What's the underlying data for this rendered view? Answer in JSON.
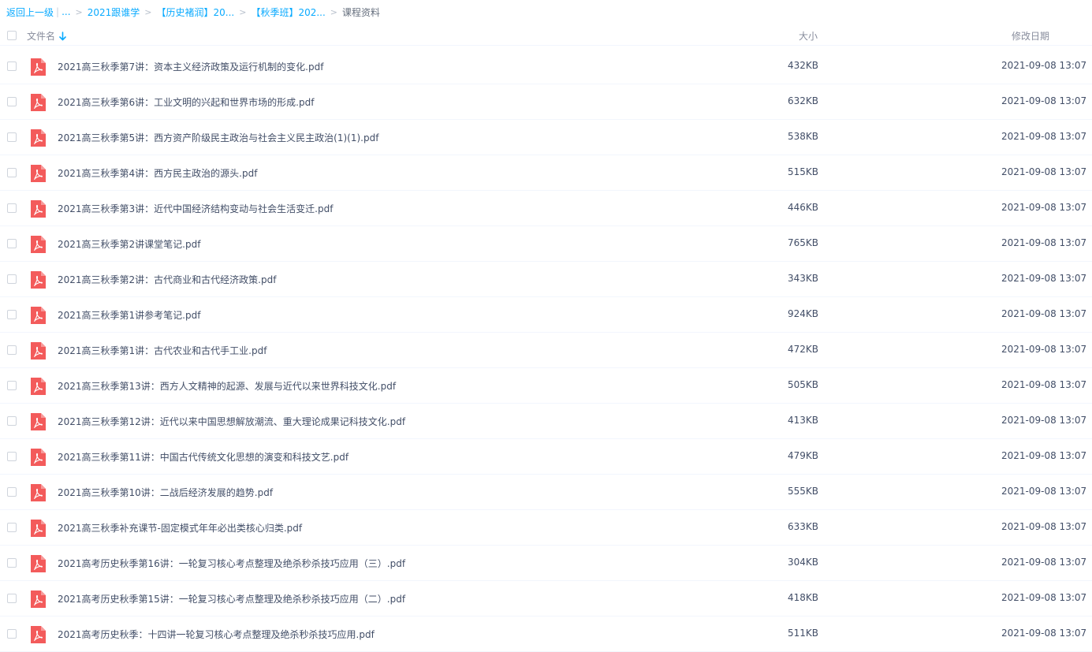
{
  "breadcrumb": {
    "back": "返回上一级",
    "ellipsis": "...",
    "items": [
      "2021跟谁学",
      "【历史褚润】20...",
      "【秋季班】202..."
    ],
    "current": "课程资料"
  },
  "header": {
    "name": "文件名",
    "size": "大小",
    "date": "修改日期"
  },
  "colors": {
    "link": "#09aaff",
    "pdf_icon": "#f35b5b",
    "text": "#424e67"
  },
  "files": [
    {
      "name": "2021高三秋季第7讲：资本主义经济政策及运行机制的变化.pdf",
      "size": "432KB",
      "date": "2021-09-08 13:07",
      "icon": "pdf-icon"
    },
    {
      "name": "2021高三秋季第6讲：工业文明的兴起和世界市场的形成.pdf",
      "size": "632KB",
      "date": "2021-09-08 13:07",
      "icon": "pdf-icon"
    },
    {
      "name": "2021高三秋季第5讲：西方资产阶级民主政治与社会主义民主政治(1)(1).pdf",
      "size": "538KB",
      "date": "2021-09-08 13:07",
      "icon": "pdf-icon"
    },
    {
      "name": "2021高三秋季第4讲：西方民主政治的源头.pdf",
      "size": "515KB",
      "date": "2021-09-08 13:07",
      "icon": "pdf-icon"
    },
    {
      "name": "2021高三秋季第3讲：近代中国经济结构变动与社会生活变迁.pdf",
      "size": "446KB",
      "date": "2021-09-08 13:07",
      "icon": "pdf-icon"
    },
    {
      "name": "2021高三秋季第2讲课堂笔记.pdf",
      "size": "765KB",
      "date": "2021-09-08 13:07",
      "icon": "pdf-icon"
    },
    {
      "name": "2021高三秋季第2讲：古代商业和古代经济政策.pdf",
      "size": "343KB",
      "date": "2021-09-08 13:07",
      "icon": "pdf-icon"
    },
    {
      "name": "2021高三秋季第1讲参考笔记.pdf",
      "size": "924KB",
      "date": "2021-09-08 13:07",
      "icon": "pdf-icon"
    },
    {
      "name": "2021高三秋季第1讲：古代农业和古代手工业.pdf",
      "size": "472KB",
      "date": "2021-09-08 13:07",
      "icon": "pdf-icon"
    },
    {
      "name": "2021高三秋季第13讲：西方人文精神的起源、发展与近代以来世界科技文化.pdf",
      "size": "505KB",
      "date": "2021-09-08 13:07",
      "icon": "pdf-icon"
    },
    {
      "name": "2021高三秋季第12讲：近代以来中国思想解放潮流、重大理论成果记科技文化.pdf",
      "size": "413KB",
      "date": "2021-09-08 13:07",
      "icon": "pdf-icon"
    },
    {
      "name": "2021高三秋季第11讲：中国古代传统文化思想的演变和科技文艺.pdf",
      "size": "479KB",
      "date": "2021-09-08 13:07",
      "icon": "pdf-icon"
    },
    {
      "name": "2021高三秋季第10讲：二战后经济发展的趋势.pdf",
      "size": "555KB",
      "date": "2021-09-08 13:07",
      "icon": "pdf-icon"
    },
    {
      "name": "2021高三秋季补充课节-固定模式年年必出类核心归类.pdf",
      "size": "633KB",
      "date": "2021-09-08 13:07",
      "icon": "pdf-icon"
    },
    {
      "name": "2021高考历史秋季第16讲：一轮复习核心考点整理及绝杀秒杀技巧应用（三）.pdf",
      "size": "304KB",
      "date": "2021-09-08 13:07",
      "icon": "pdf-icon"
    },
    {
      "name": "2021高考历史秋季第15讲：一轮复习核心考点整理及绝杀秒杀技巧应用（二）.pdf",
      "size": "418KB",
      "date": "2021-09-08 13:07",
      "icon": "pdf-icon"
    },
    {
      "name": "2021高考历史秋季：十四讲一轮复习核心考点整理及绝杀秒杀技巧应用.pdf",
      "size": "511KB",
      "date": "2021-09-08 13:07",
      "icon": "pdf-icon"
    }
  ]
}
